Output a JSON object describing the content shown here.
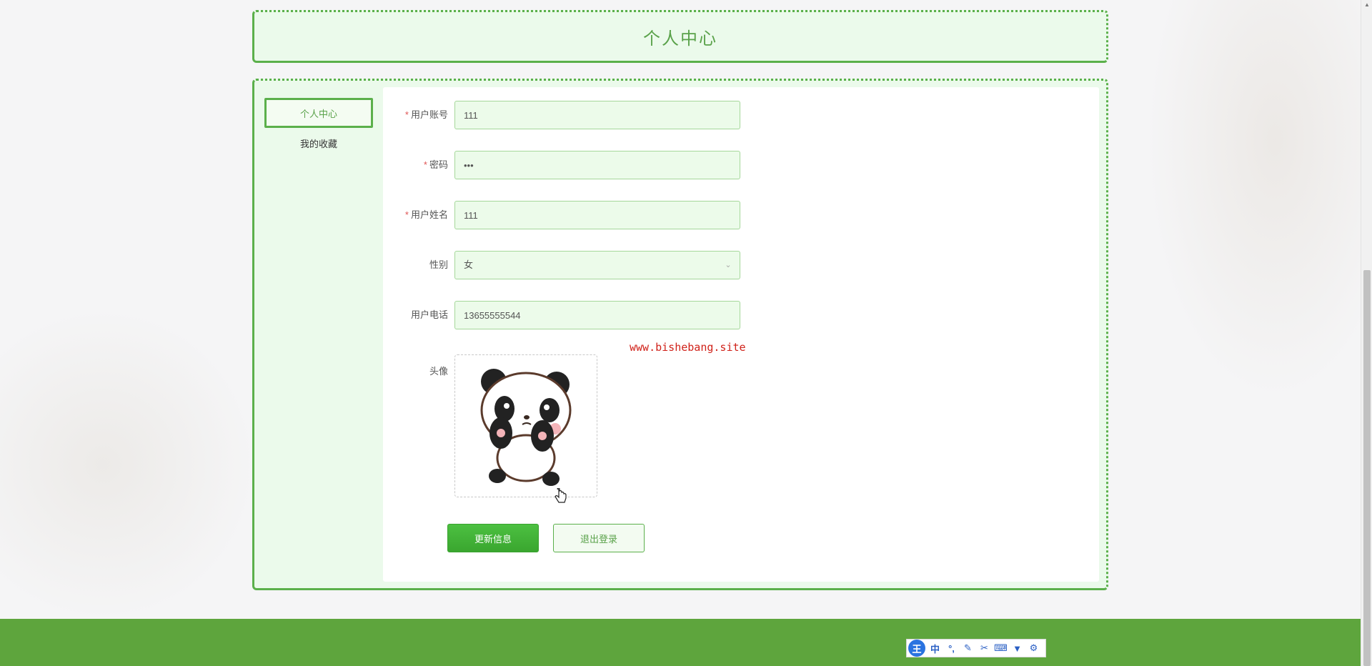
{
  "page": {
    "title": "个人中心"
  },
  "sidebar": {
    "items": [
      {
        "label": "个人中心",
        "active": true
      },
      {
        "label": "我的收藏",
        "active": false
      }
    ]
  },
  "form": {
    "account": {
      "label": "用户账号",
      "required": true,
      "value": "111"
    },
    "password": {
      "label": "密码",
      "required": true,
      "value": "•••"
    },
    "name": {
      "label": "用户姓名",
      "required": true,
      "value": "111"
    },
    "gender": {
      "label": "性别",
      "required": false,
      "value": "女"
    },
    "phone": {
      "label": "用户电话",
      "required": false,
      "value": "13655555544"
    },
    "avatar": {
      "label": "头像",
      "image": "panda-avatar"
    }
  },
  "watermark": "www.bishebang.site",
  "buttons": {
    "update": "更新信息",
    "logout": "退出登录"
  },
  "ime_toolbar": {
    "logo": "王",
    "items": [
      "中",
      "°,",
      "pen-icon",
      "scissors-icon",
      "keyboard-icon",
      "shirt-icon",
      "gear-icon"
    ],
    "lang_label": "中"
  },
  "colors": {
    "accent": "#5bb04b",
    "button_primary": "#3aa62f",
    "footer": "#5ea53d",
    "watermark": "#d0221a"
  }
}
